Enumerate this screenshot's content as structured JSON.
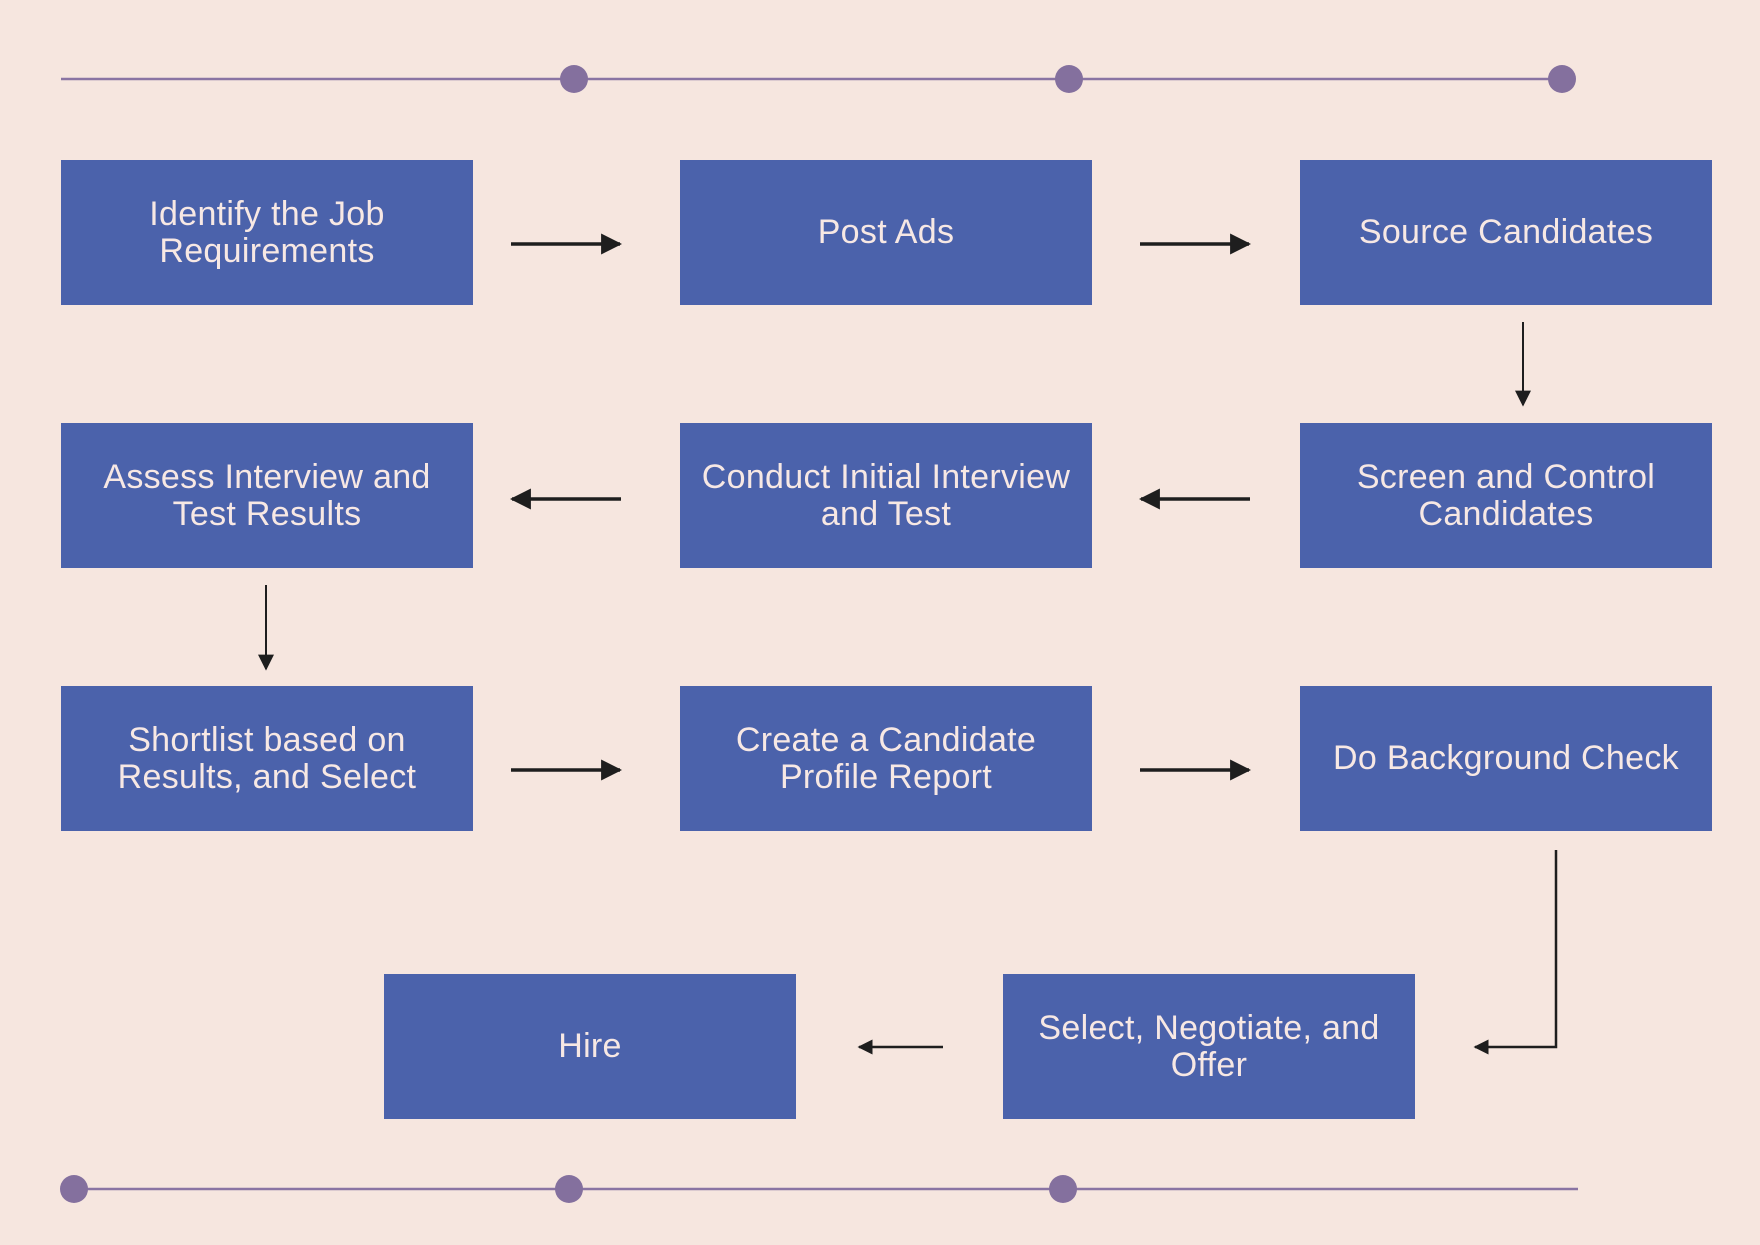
{
  "diagram": {
    "type": "flowchart",
    "theme": {
      "background": "#f6e6df",
      "box_fill": "#4b62ab",
      "box_text": "#f7e8e4",
      "arrow": "#1e1e1e",
      "decor_line": "#8a74a3",
      "decor_dot": "#84709e"
    },
    "steps": [
      {
        "id": "identify",
        "label": "Identify the Job Requirements"
      },
      {
        "id": "post",
        "label": "Post Ads"
      },
      {
        "id": "source",
        "label": "Source Candidates"
      },
      {
        "id": "screen",
        "label": "Screen and Control Candidates"
      },
      {
        "id": "conduct",
        "label": "Conduct Initial Interview and Test"
      },
      {
        "id": "assess",
        "label": "Assess Interview and Test Results"
      },
      {
        "id": "shortlist",
        "label": "Shortlist based on Results, and Select"
      },
      {
        "id": "profile",
        "label": "Create a Candidate Profile Report"
      },
      {
        "id": "background",
        "label": "Do Background Check"
      },
      {
        "id": "offer",
        "label": "Select, Negotiate, and Offer"
      },
      {
        "id": "hire",
        "label": "Hire"
      }
    ],
    "edges": [
      {
        "from": "identify",
        "to": "post"
      },
      {
        "from": "post",
        "to": "source"
      },
      {
        "from": "source",
        "to": "screen"
      },
      {
        "from": "screen",
        "to": "conduct"
      },
      {
        "from": "conduct",
        "to": "assess"
      },
      {
        "from": "assess",
        "to": "shortlist"
      },
      {
        "from": "shortlist",
        "to": "profile"
      },
      {
        "from": "profile",
        "to": "background"
      },
      {
        "from": "background",
        "to": "offer"
      },
      {
        "from": "offer",
        "to": "hire"
      }
    ],
    "decorations": {
      "top_timeline_dots": 3,
      "bottom_timeline_dots": 3
    }
  }
}
